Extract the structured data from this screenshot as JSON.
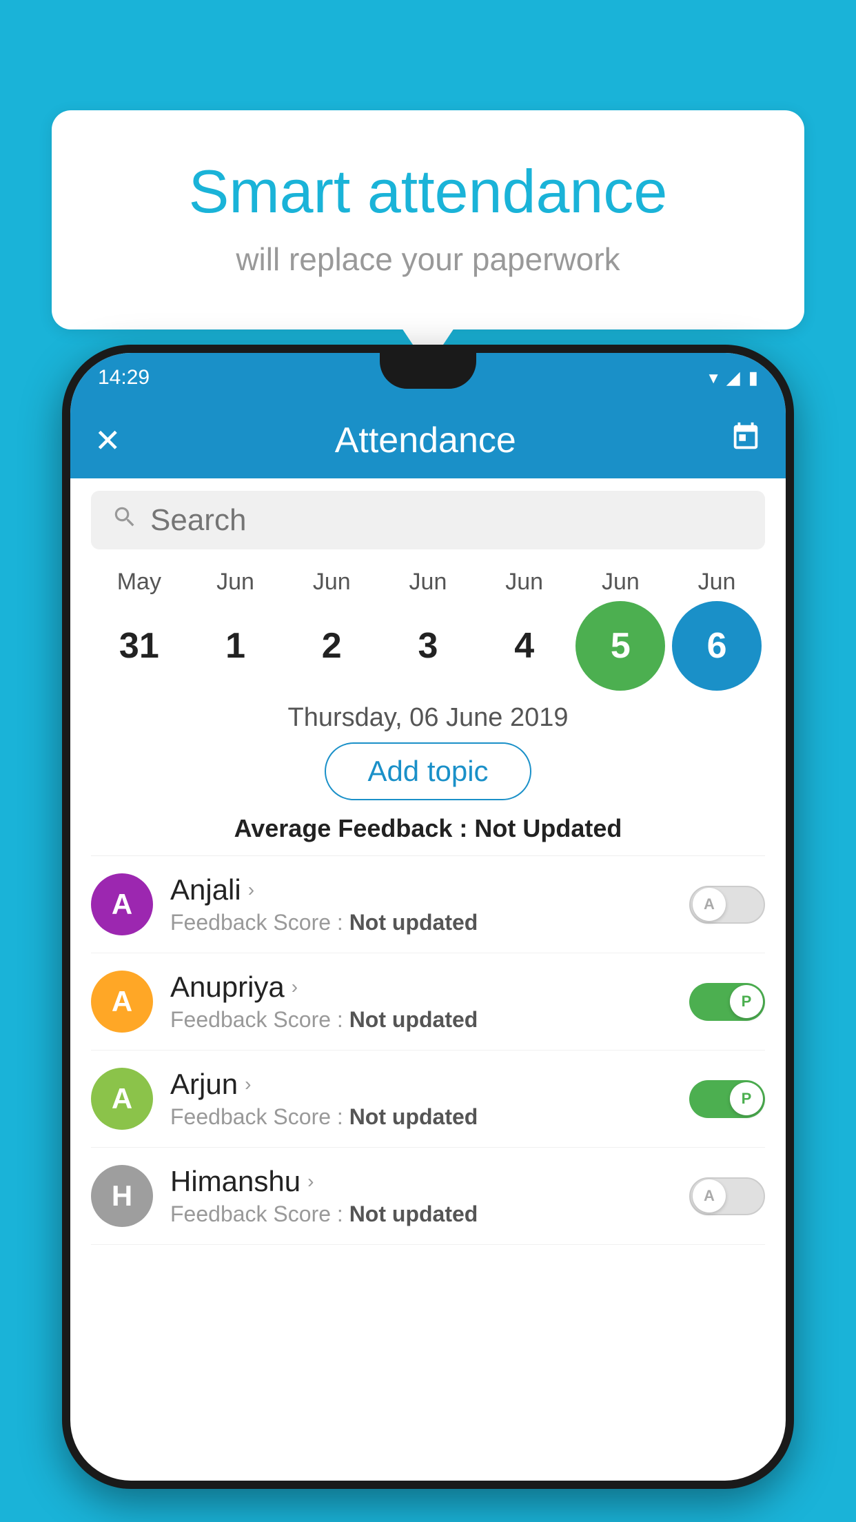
{
  "background_color": "#1ab3d8",
  "speech_bubble": {
    "title": "Smart attendance",
    "subtitle": "will replace your paperwork"
  },
  "status_bar": {
    "time": "14:29"
  },
  "app_bar": {
    "title": "Attendance",
    "close_label": "✕",
    "calendar_label": "📅"
  },
  "search": {
    "placeholder": "Search"
  },
  "calendar": {
    "months": [
      "May",
      "Jun",
      "Jun",
      "Jun",
      "Jun",
      "Jun",
      "Jun"
    ],
    "dates": [
      "31",
      "1",
      "2",
      "3",
      "4",
      "5",
      "6"
    ],
    "today_index": 5,
    "selected_index": 6
  },
  "selected_date": "Thursday, 06 June 2019",
  "add_topic_label": "Add topic",
  "avg_feedback": {
    "label": "Average Feedback :",
    "value": "Not Updated"
  },
  "students": [
    {
      "name": "Anjali",
      "avatar_letter": "A",
      "avatar_color": "#9c27b0",
      "feedback": "Feedback Score : Not updated",
      "toggle": "off",
      "toggle_label": "A"
    },
    {
      "name": "Anupriya",
      "avatar_letter": "A",
      "avatar_color": "#ffa726",
      "feedback": "Feedback Score : Not updated",
      "toggle": "on",
      "toggle_label": "P"
    },
    {
      "name": "Arjun",
      "avatar_letter": "A",
      "avatar_color": "#8bc34a",
      "feedback": "Feedback Score : Not updated",
      "toggle": "on",
      "toggle_label": "P"
    },
    {
      "name": "Himanshu",
      "avatar_letter": "H",
      "avatar_color": "#9e9e9e",
      "feedback": "Feedback Score : Not updated",
      "toggle": "off",
      "toggle_label": "A"
    }
  ]
}
